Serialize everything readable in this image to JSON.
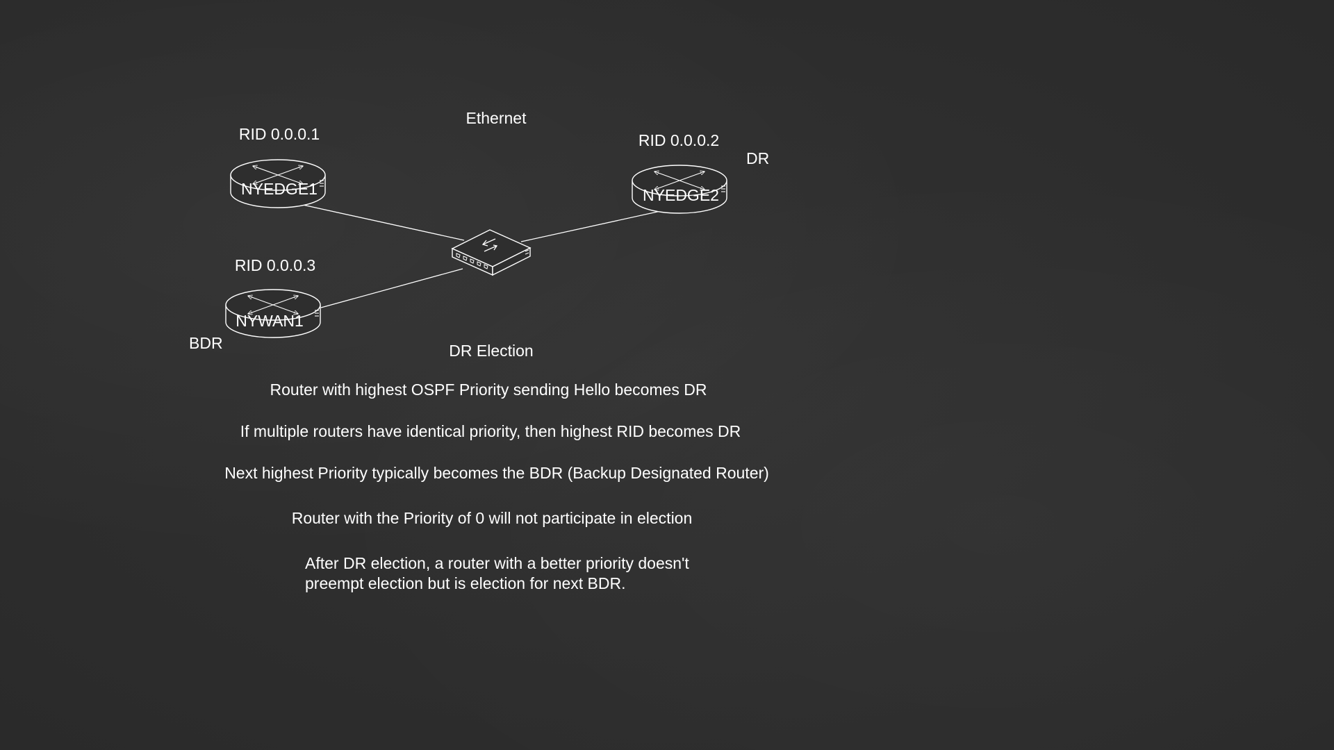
{
  "network": {
    "medium_label": "Ethernet",
    "routers": [
      {
        "rid": "RID 0.0.0.1",
        "name": "NYEDGE1",
        "role": ""
      },
      {
        "rid": "RID 0.0.0.2",
        "name": "NYEDGE2",
        "role": "DR"
      },
      {
        "rid": "RID 0.0.0.3",
        "name": "NYWAN1",
        "role": "BDR"
      }
    ]
  },
  "election": {
    "title": "DR Election",
    "points": [
      "Router with highest OSPF Priority sending Hello becomes DR",
      "If multiple routers have identical priority, then highest RID becomes DR",
      "Next highest Priority typically becomes the BDR (Backup Designated Router)",
      "Router with the Priority of 0 will not participate in election",
      "After DR election, a router with a better priority doesn't\npreempt election but is election for next BDR."
    ]
  },
  "colors": {
    "background": "#2d2d2d",
    "foreground": "#ffffff"
  },
  "icons": {
    "router": "router-icon",
    "switch": "switch-icon"
  }
}
